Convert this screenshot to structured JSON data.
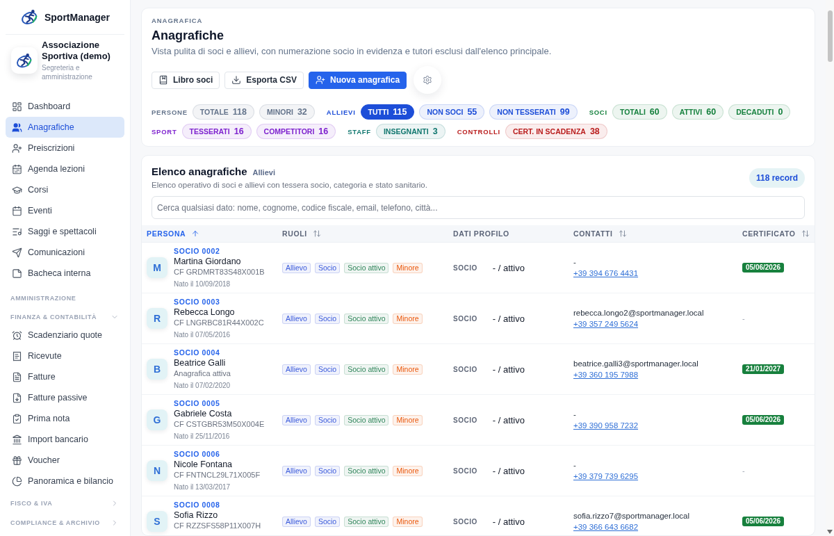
{
  "sidebar": {
    "brand": "SportManager",
    "org": {
      "name": "Associazione Sportiva (demo)",
      "subtitle": "Segreteria e amministrazione"
    },
    "nav": [
      {
        "label": "Dashboard",
        "selected": false
      },
      {
        "label": "Anagrafiche",
        "selected": true
      },
      {
        "label": "Preiscrizioni",
        "selected": false
      },
      {
        "label": "Agenda lezioni",
        "selected": false
      },
      {
        "label": "Corsi",
        "selected": false
      },
      {
        "label": "Eventi",
        "selected": false
      },
      {
        "label": "Saggi e spettacoli",
        "selected": false
      },
      {
        "label": "Comunicazioni",
        "selected": false
      },
      {
        "label": "Bacheca interna",
        "selected": false
      }
    ],
    "admin_heading": "AMMINISTRAZIONE",
    "sections": [
      {
        "title": "FINANZA & CONTABILITÀ",
        "expanded": true,
        "items": [
          {
            "label": "Scadenziario quote",
            "selected": false
          },
          {
            "label": "Ricevute",
            "selected": false
          },
          {
            "label": "Fatture",
            "selected": false
          },
          {
            "label": "Fatture passive",
            "selected": false
          },
          {
            "label": "Prima nota",
            "selected": false
          },
          {
            "label": "Import bancario",
            "selected": false
          },
          {
            "label": "Voucher",
            "selected": false
          },
          {
            "label": "Panoramica e bilancio",
            "selected": false
          }
        ]
      },
      {
        "title": "FISCO & IVA",
        "expanded": false
      },
      {
        "title": "COMPLIANCE & ARCHIVIO",
        "expanded": false
      }
    ]
  },
  "header": {
    "eyebrow": "ANAGRAFICA",
    "title": "Anagrafiche",
    "subtitle": "Vista pulita di soci e allievi, con numerazione socio in evidenza e tutori esclusi dall'elenco principale.",
    "actions": [
      {
        "kind": "outline",
        "label": "Libro soci"
      },
      {
        "kind": "outline",
        "label": "Esporta CSV"
      },
      {
        "kind": "primary",
        "label": "Nuova anagrafica"
      },
      {
        "kind": "icon"
      }
    ]
  },
  "filters": [
    {
      "label": "PERSONE",
      "color": "#64748b",
      "chips": [
        {
          "label": "TOTALE",
          "count": "118",
          "selected": false
        },
        {
          "label": "MINORI",
          "count": "32",
          "selected": false
        }
      ]
    },
    {
      "label": "ALLIEVI",
      "color": "#1d4ed8",
      "chips": [
        {
          "label": "TUTTI",
          "count": "115",
          "selected": true
        },
        {
          "label": "NON SOCI",
          "count": "55",
          "selected": false
        },
        {
          "label": "NON TESSERATI",
          "count": "99",
          "selected": false
        }
      ]
    },
    {
      "label": "SOCI",
      "color": "#15803d",
      "chips": [
        {
          "label": "TOTALI",
          "count": "60",
          "selected": false
        },
        {
          "label": "ATTIVI",
          "count": "60",
          "selected": false
        },
        {
          "label": "DECADUTI",
          "count": "0",
          "selected": false
        }
      ]
    },
    {
      "label": "SPORT",
      "color": "#7e22ce",
      "chips": [
        {
          "label": "TESSERATI",
          "count": "16",
          "selected": false
        },
        {
          "label": "COMPETITORI",
          "count": "16",
          "selected": false
        }
      ]
    },
    {
      "label": "STAFF",
      "color": "#0f766e",
      "chips": [
        {
          "label": "INSEGNANTI",
          "count": "3",
          "selected": false
        }
      ]
    },
    {
      "label": "CONTROLLI",
      "color": "#b91c1c",
      "chips": [
        {
          "label": "CERT. IN SCADENZA",
          "count": "38",
          "selected": false
        }
      ]
    }
  ],
  "list": {
    "title": "Elenco anagrafiche",
    "filter_label": "Allievi",
    "record_count": "118 record",
    "description": "Elenco operativo di soci e allievi con tessera socio, categoria e stato sanitario.",
    "search": {
      "placeholder": "Cerca qualsiasi dato: nome, cognome, codice fiscale, email, telefono, città..."
    },
    "columns": [
      {
        "label": "PERSONA",
        "sortable": true,
        "sorted": true
      },
      {
        "label": "RUOLI",
        "sortable": true,
        "sorted": false
      },
      {
        "label": "DATI PROFILO",
        "sortable": false,
        "sorted": false
      },
      {
        "label": "CONTATTI",
        "sortable": true,
        "sorted": false
      },
      {
        "label": "CERTIFICATO",
        "sortable": true,
        "sorted": false
      }
    ],
    "rows": [
      {
        "avatar": "M",
        "member_no": "SOCIO 0002",
        "name": "Martina Giordano",
        "detail": "CF GRDMRT83S48X001B",
        "born": "Nato il 10/09/2018",
        "roles": [
          {
            "label": "Allievo",
            "color": "#3b5bdb"
          },
          {
            "label": "Socio",
            "color": "#3b5bdb"
          },
          {
            "label": "Socio attivo",
            "color": "#2f855a"
          },
          {
            "label": "Minore",
            "color": "#ea580c"
          }
        ],
        "profile_type": "SOCIO",
        "profile_status": "- / attivo",
        "email": "-",
        "phone": "+39 394 676 4431",
        "certificate": {
          "kind": "badge",
          "text": "05/06/2026"
        }
      },
      {
        "avatar": "R",
        "member_no": "SOCIO 0003",
        "name": "Rebecca Longo",
        "detail": "CF LNGRBC81R44X002C",
        "born": "Nato il 07/05/2016",
        "roles": [
          {
            "label": "Allievo",
            "color": "#3b5bdb"
          },
          {
            "label": "Socio",
            "color": "#3b5bdb"
          },
          {
            "label": "Socio attivo",
            "color": "#2f855a"
          },
          {
            "label": "Minore",
            "color": "#ea580c"
          }
        ],
        "profile_type": "SOCIO",
        "profile_status": "- / attivo",
        "email": "rebecca.longo2@sportmanager.local",
        "phone": "+39 357 249 5624",
        "certificate": {
          "kind": "empty",
          "text": "-"
        }
      },
      {
        "avatar": "B",
        "member_no": "SOCIO 0004",
        "name": "Beatrice Galli",
        "detail": "Anagrafica attiva",
        "born": "Nato il 07/02/2020",
        "roles": [
          {
            "label": "Allievo",
            "color": "#3b5bdb"
          },
          {
            "label": "Socio",
            "color": "#3b5bdb"
          },
          {
            "label": "Socio attivo",
            "color": "#2f855a"
          },
          {
            "label": "Minore",
            "color": "#ea580c"
          }
        ],
        "profile_type": "SOCIO",
        "profile_status": "- / attivo",
        "email": "beatrice.galli3@sportmanager.local",
        "phone": "+39 360 195 7988",
        "certificate": {
          "kind": "badge",
          "text": "21/01/2027"
        }
      },
      {
        "avatar": "G",
        "member_no": "SOCIO 0005",
        "name": "Gabriele Costa",
        "detail": "CF CSTGBR53M50X004E",
        "born": "Nato il 25/11/2016",
        "roles": [
          {
            "label": "Allievo",
            "color": "#3b5bdb"
          },
          {
            "label": "Socio",
            "color": "#3b5bdb"
          },
          {
            "label": "Socio attivo",
            "color": "#2f855a"
          },
          {
            "label": "Minore",
            "color": "#ea580c"
          }
        ],
        "profile_type": "SOCIO",
        "profile_status": "- / attivo",
        "email": "-",
        "phone": "+39 390 958 7232",
        "certificate": {
          "kind": "badge",
          "text": "05/06/2026"
        }
      },
      {
        "avatar": "N",
        "member_no": "SOCIO 0006",
        "name": "Nicole Fontana",
        "detail": "CF FNTNCL29L71X005F",
        "born": "Nato il 13/03/2017",
        "roles": [
          {
            "label": "Allievo",
            "color": "#3b5bdb"
          },
          {
            "label": "Socio",
            "color": "#3b5bdb"
          },
          {
            "label": "Socio attivo",
            "color": "#2f855a"
          },
          {
            "label": "Minore",
            "color": "#ea580c"
          }
        ],
        "profile_type": "SOCIO",
        "profile_status": "- / attivo",
        "email": "-",
        "phone": "+39 379 739 6295",
        "certificate": {
          "kind": "empty",
          "text": "-"
        }
      },
      {
        "avatar": "S",
        "member_no": "SOCIO 0008",
        "name": "Sofia Rizzo",
        "detail": "CF RZZSFS58P11X007H",
        "roles": [
          {
            "label": "Allievo",
            "color": "#3b5bdb"
          },
          {
            "label": "Socio",
            "color": "#3b5bdb"
          },
          {
            "label": "Socio attivo",
            "color": "#2f855a"
          },
          {
            "label": "Minore",
            "color": "#ea580c"
          }
        ],
        "profile_type": "SOCIO",
        "profile_status": "- / attivo",
        "email": "sofia.rizzo7@sportmanager.local",
        "phone": "+39 366 643 6682",
        "certificate": {
          "kind": "badge",
          "text": "05/06/2026"
        }
      }
    ]
  }
}
